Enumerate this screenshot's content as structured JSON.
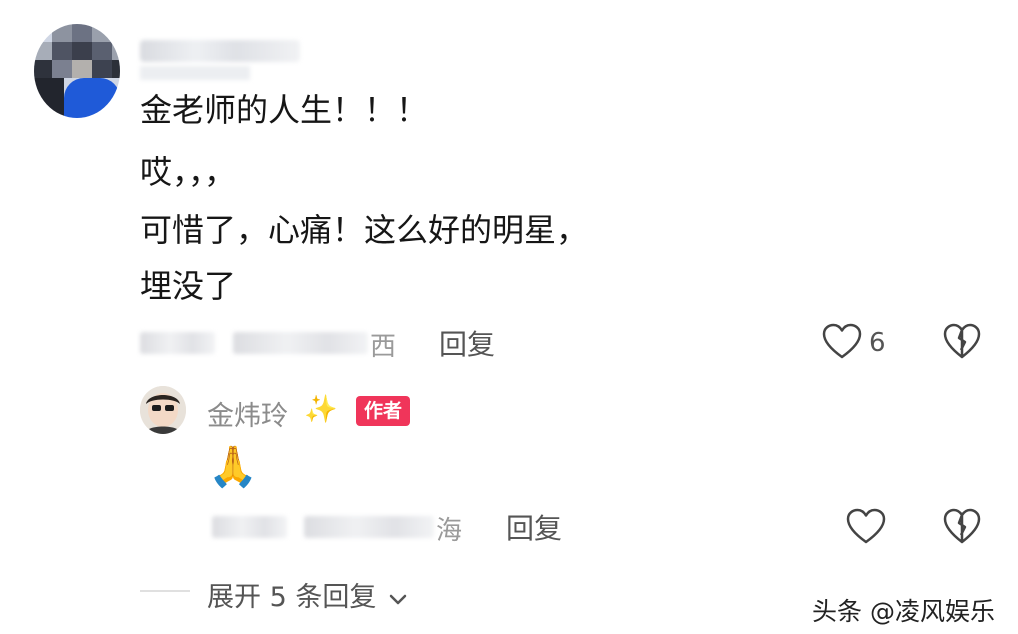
{
  "comment": {
    "lines": [
      "金老师的人生！！！",
      "哎，，，",
      "可惜了，心痛！这么好的明星，",
      "埋没了"
    ],
    "meta_location_tail": "西",
    "reply_label": "回复",
    "like_count": "6"
  },
  "reply": {
    "author_name": "金炜玲",
    "sparkle": "✨",
    "author_badge": "作者",
    "content_emoji": "🙏",
    "meta_location_tail": "海",
    "reply_label": "回复"
  },
  "expand": {
    "label": "展开 5 条回复",
    "chevron": "⌄"
  },
  "watermark": "头条 @凌风娱乐",
  "icons": [
    "heart-icon",
    "heart-broken-icon",
    "chevron-down-icon"
  ],
  "colors": {
    "author_badge": "#f0355a",
    "avatar_shirt": "#1f5ad8",
    "muted_text": "#8b8b8b"
  }
}
